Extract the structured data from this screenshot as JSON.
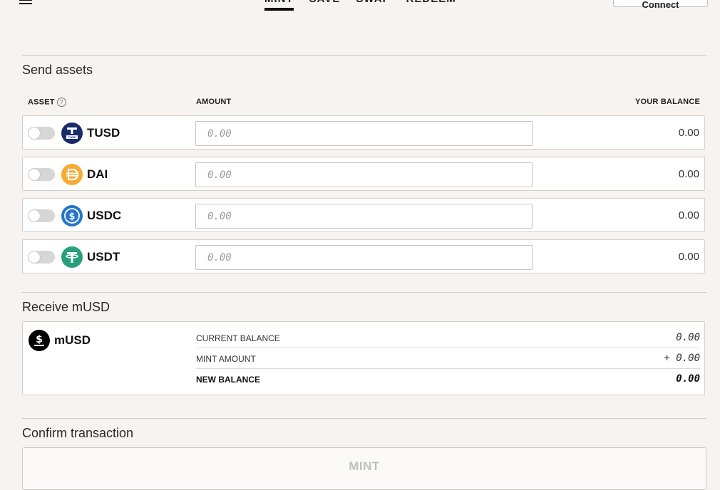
{
  "nav": {
    "tabs": [
      "MINT",
      "SAVE",
      "SWAP",
      "REDEEM"
    ],
    "active_tab": "MINT",
    "connect_label": "Connect"
  },
  "send": {
    "title": "Send assets",
    "columns": {
      "asset": "ASSET",
      "amount": "AMOUNT",
      "balance": "YOUR BALANCE"
    },
    "assets": [
      {
        "symbol": "TUSD",
        "icon": "tusd-icon",
        "color": "#1a2b6b",
        "placeholder": "0.00",
        "balance": "0.00"
      },
      {
        "symbol": "DAI",
        "icon": "dai-icon",
        "color": "#f5ac37",
        "placeholder": "0.00",
        "balance": "0.00"
      },
      {
        "symbol": "USDC",
        "icon": "usdc-icon",
        "color": "#2775ca",
        "placeholder": "0.00",
        "balance": "0.00"
      },
      {
        "symbol": "USDT",
        "icon": "usdt-icon",
        "color": "#26a17b",
        "placeholder": "0.00",
        "balance": "0.00"
      }
    ]
  },
  "receive": {
    "title": "Receive mUSD",
    "token": "mUSD",
    "rows": [
      {
        "label": "CURRENT BALANCE",
        "value": "0.00"
      },
      {
        "label": "MINT AMOUNT",
        "value": "+ 0.00"
      },
      {
        "label": "NEW BALANCE",
        "value": "0.00"
      }
    ]
  },
  "confirm": {
    "title": "Confirm transaction",
    "button_label": "MINT"
  }
}
